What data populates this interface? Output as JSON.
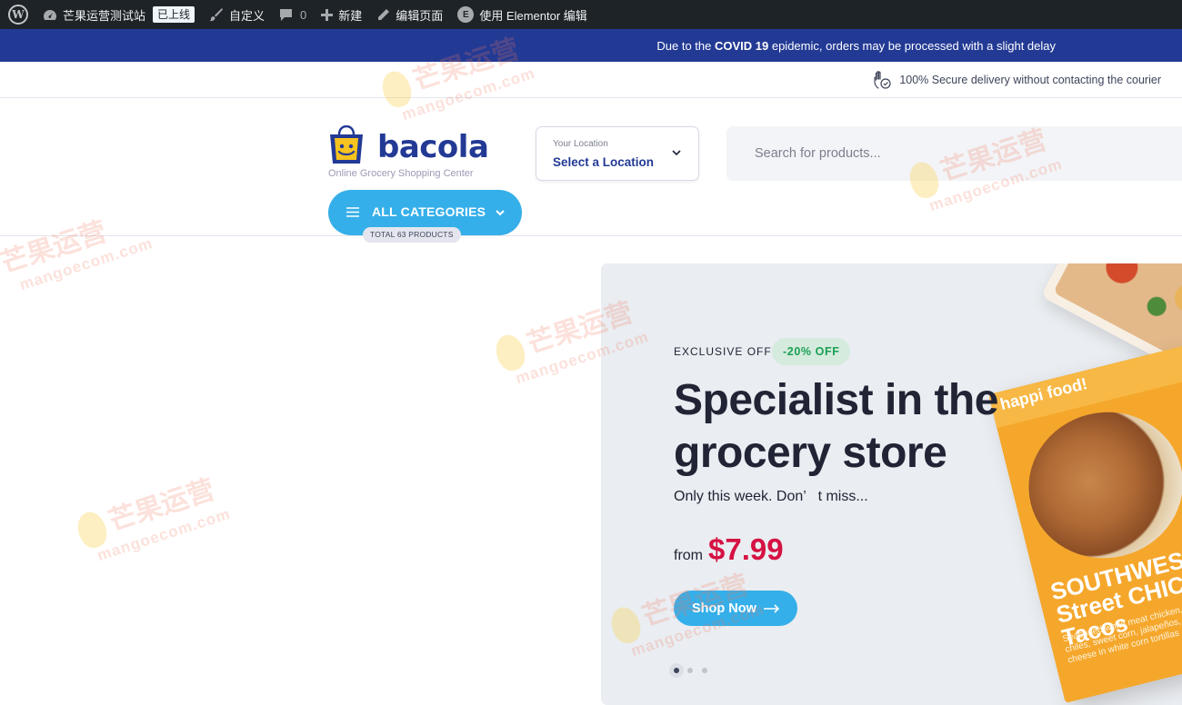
{
  "adminbar": {
    "site_name": "芒果运营测试站",
    "badge": "已上线",
    "customize": "自定义",
    "comments_count": "0",
    "new": "新建",
    "edit_page": "编辑页面",
    "elementor_edit": "使用 Elementor 编辑"
  },
  "notice": {
    "prefix": "Due to the ",
    "bold": "COVID 19",
    "suffix": " epidemic, orders may be processed with a slight delay"
  },
  "topline": {
    "secure_text": "100% Secure delivery without contacting the courier"
  },
  "header": {
    "logo_name": "bacola",
    "logo_sub": "Online Grocery Shopping Center",
    "location_small": "Your Location",
    "location_main": "Select a Location",
    "search_placeholder": "Search for products...",
    "all_categories": "ALL CATEGORIES",
    "total_products": "TOTAL 63 PRODUCTS"
  },
  "hero": {
    "offer": "EXCLUSIVE OFFER",
    "discount": "-20% OFF",
    "headline": "Specialist in the grocery store",
    "sub": "Only this week. Don’   t miss...",
    "from": "from",
    "price": "$7.99",
    "shop_now": "Shop Now",
    "box_brand": "happi food!",
    "box_title": "SOUTHWESTERN Street CHICKEN Tacos",
    "box_text": "Seasoned white meat chicken, onions, green chiles, sweet corn, jalapeños, cilantro & cotija cheese in white corn tortillas"
  },
  "watermark": {
    "cn": "芒果运营",
    "en": "mangoecom.com"
  },
  "colors": {
    "adminbar": "#1d2327",
    "notice": "#233a95",
    "accent": "#35afe9",
    "price": "#d51243",
    "discount": "#1a9f55"
  }
}
